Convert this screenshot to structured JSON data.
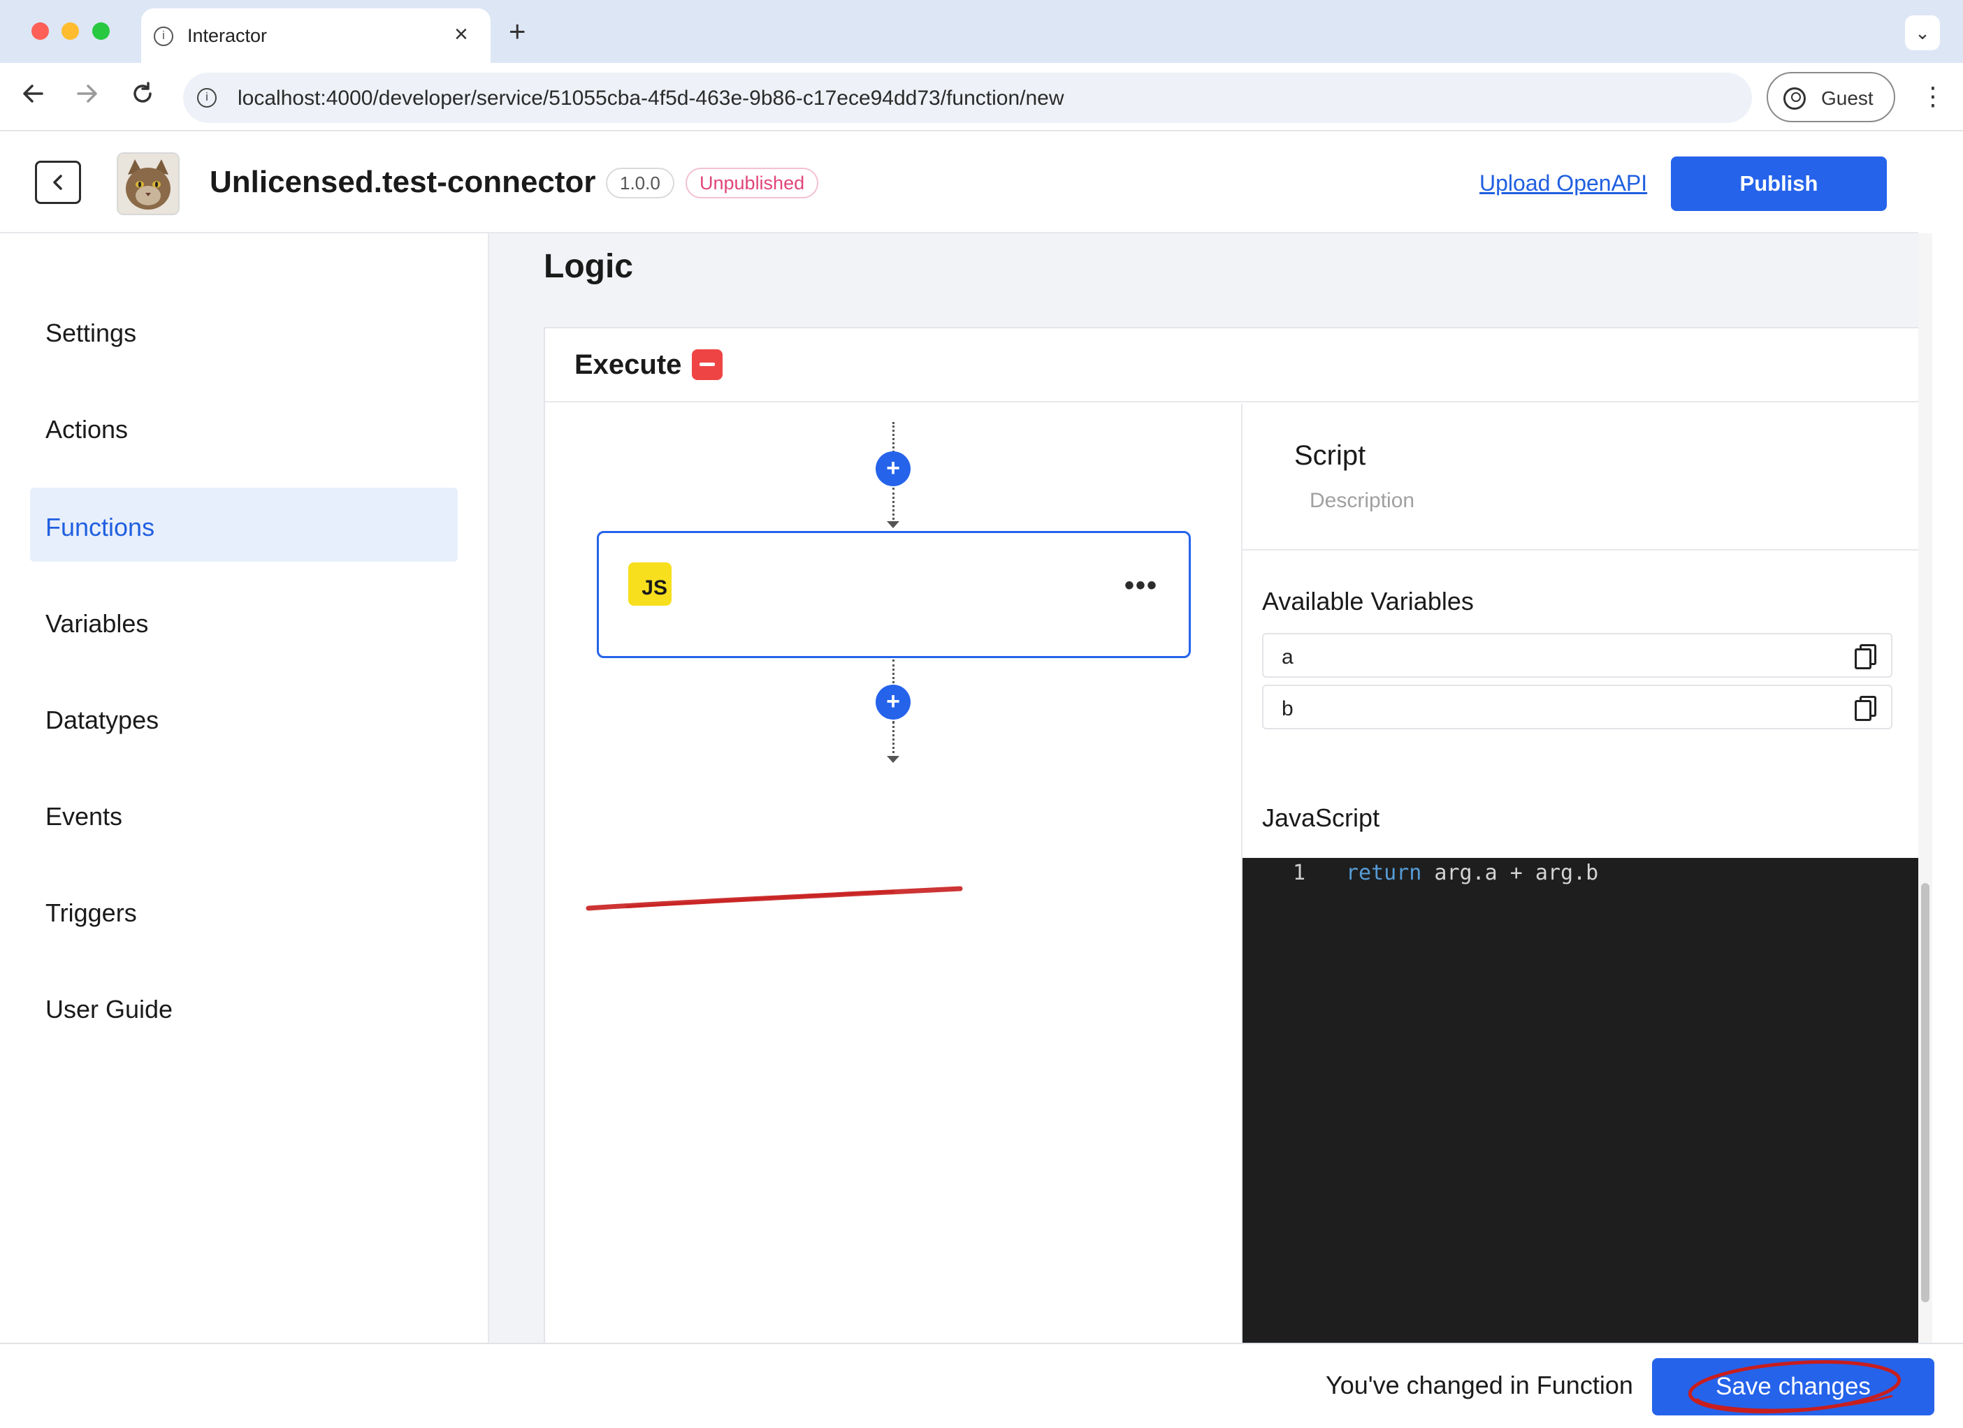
{
  "browser": {
    "tab_title": "Interactor",
    "tab_close": "×",
    "new_tab": "+",
    "tab_menu": "⌄",
    "url": "localhost:4000/developer/service/51055cba-4f5d-463e-9b86-c17ece94dd73/function/new",
    "profile_label": "Guest",
    "icons": {
      "back": "arrow-left-icon",
      "forward": "arrow-right-icon",
      "reload": "reload-icon",
      "site_info": "info-icon",
      "menu": "kebab-menu-icon"
    }
  },
  "header": {
    "back_icon": "chevron-left-icon",
    "title": "Unlicensed.test-connector",
    "version": "1.0.0",
    "status": "Unpublished",
    "upload_link": "Upload OpenAPI",
    "publish_label": "Publish"
  },
  "sidebar": {
    "items": [
      {
        "label": "Settings",
        "active": false
      },
      {
        "label": "Actions",
        "active": false
      },
      {
        "label": "Functions",
        "active": true
      },
      {
        "label": "Variables",
        "active": false
      },
      {
        "label": "Datatypes",
        "active": false
      },
      {
        "label": "Events",
        "active": false
      },
      {
        "label": "Triggers",
        "active": false
      },
      {
        "label": "User Guide",
        "active": false
      }
    ]
  },
  "main": {
    "section_title": "Logic",
    "execute_title": "Execute",
    "flow": {
      "add_label": "+",
      "node_badge": "JS",
      "node_menu": "•••"
    },
    "panel": {
      "script_title": "Script",
      "description_placeholder": "Description",
      "variables_title": "Available Variables",
      "variables": [
        "a",
        "b"
      ],
      "javascript_title": "JavaScript",
      "code": {
        "line_number": "1",
        "keyword": "return",
        "rest": " arg.a + arg.b"
      }
    }
  },
  "footer": {
    "message": "You've changed in Function",
    "save_label": "Save changes"
  },
  "colors": {
    "accent": "#2563eb",
    "danger": "#ef4444",
    "badge_pink": "#e0457b",
    "annotation_red": "#c81e1e",
    "editor_bg": "#1e1e1e"
  }
}
